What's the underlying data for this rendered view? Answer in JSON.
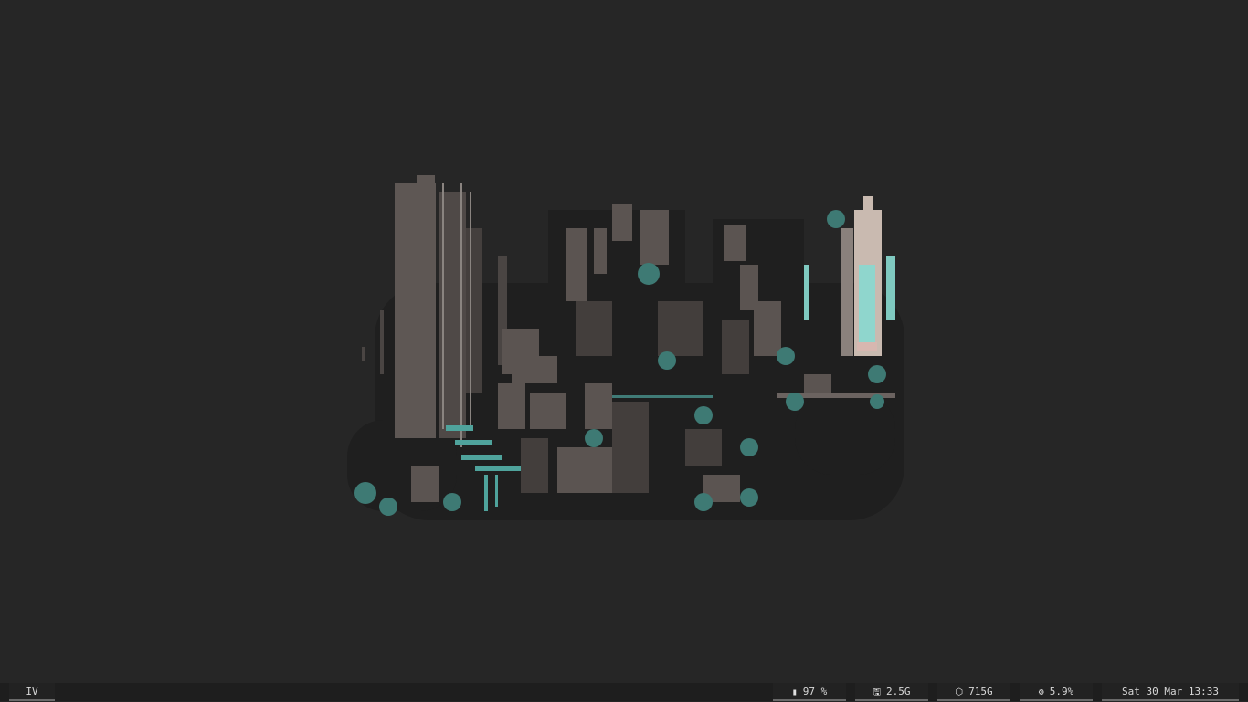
{
  "bar": {
    "workspace": "IV",
    "battery": {
      "icon": "battery-icon",
      "value": "97 %"
    },
    "memory": {
      "icon": "floppy-disk-icon",
      "value": "2.5G"
    },
    "disk": {
      "icon": "package-box-icon",
      "value": "715G"
    },
    "cpu": {
      "icon": "gears-icon",
      "value": "5.9%"
    },
    "clock": "Sat 30 Mar 13:33"
  },
  "colors": {
    "background": "#262626",
    "bar_background": "#1e1e1e",
    "module_background": "#222222",
    "module_underline": "#6a6a6a",
    "text": "#d8d8d8",
    "art_stone": "#6b6360",
    "art_teal": "#5fb8b0",
    "art_dark": "#1f1f1f"
  }
}
